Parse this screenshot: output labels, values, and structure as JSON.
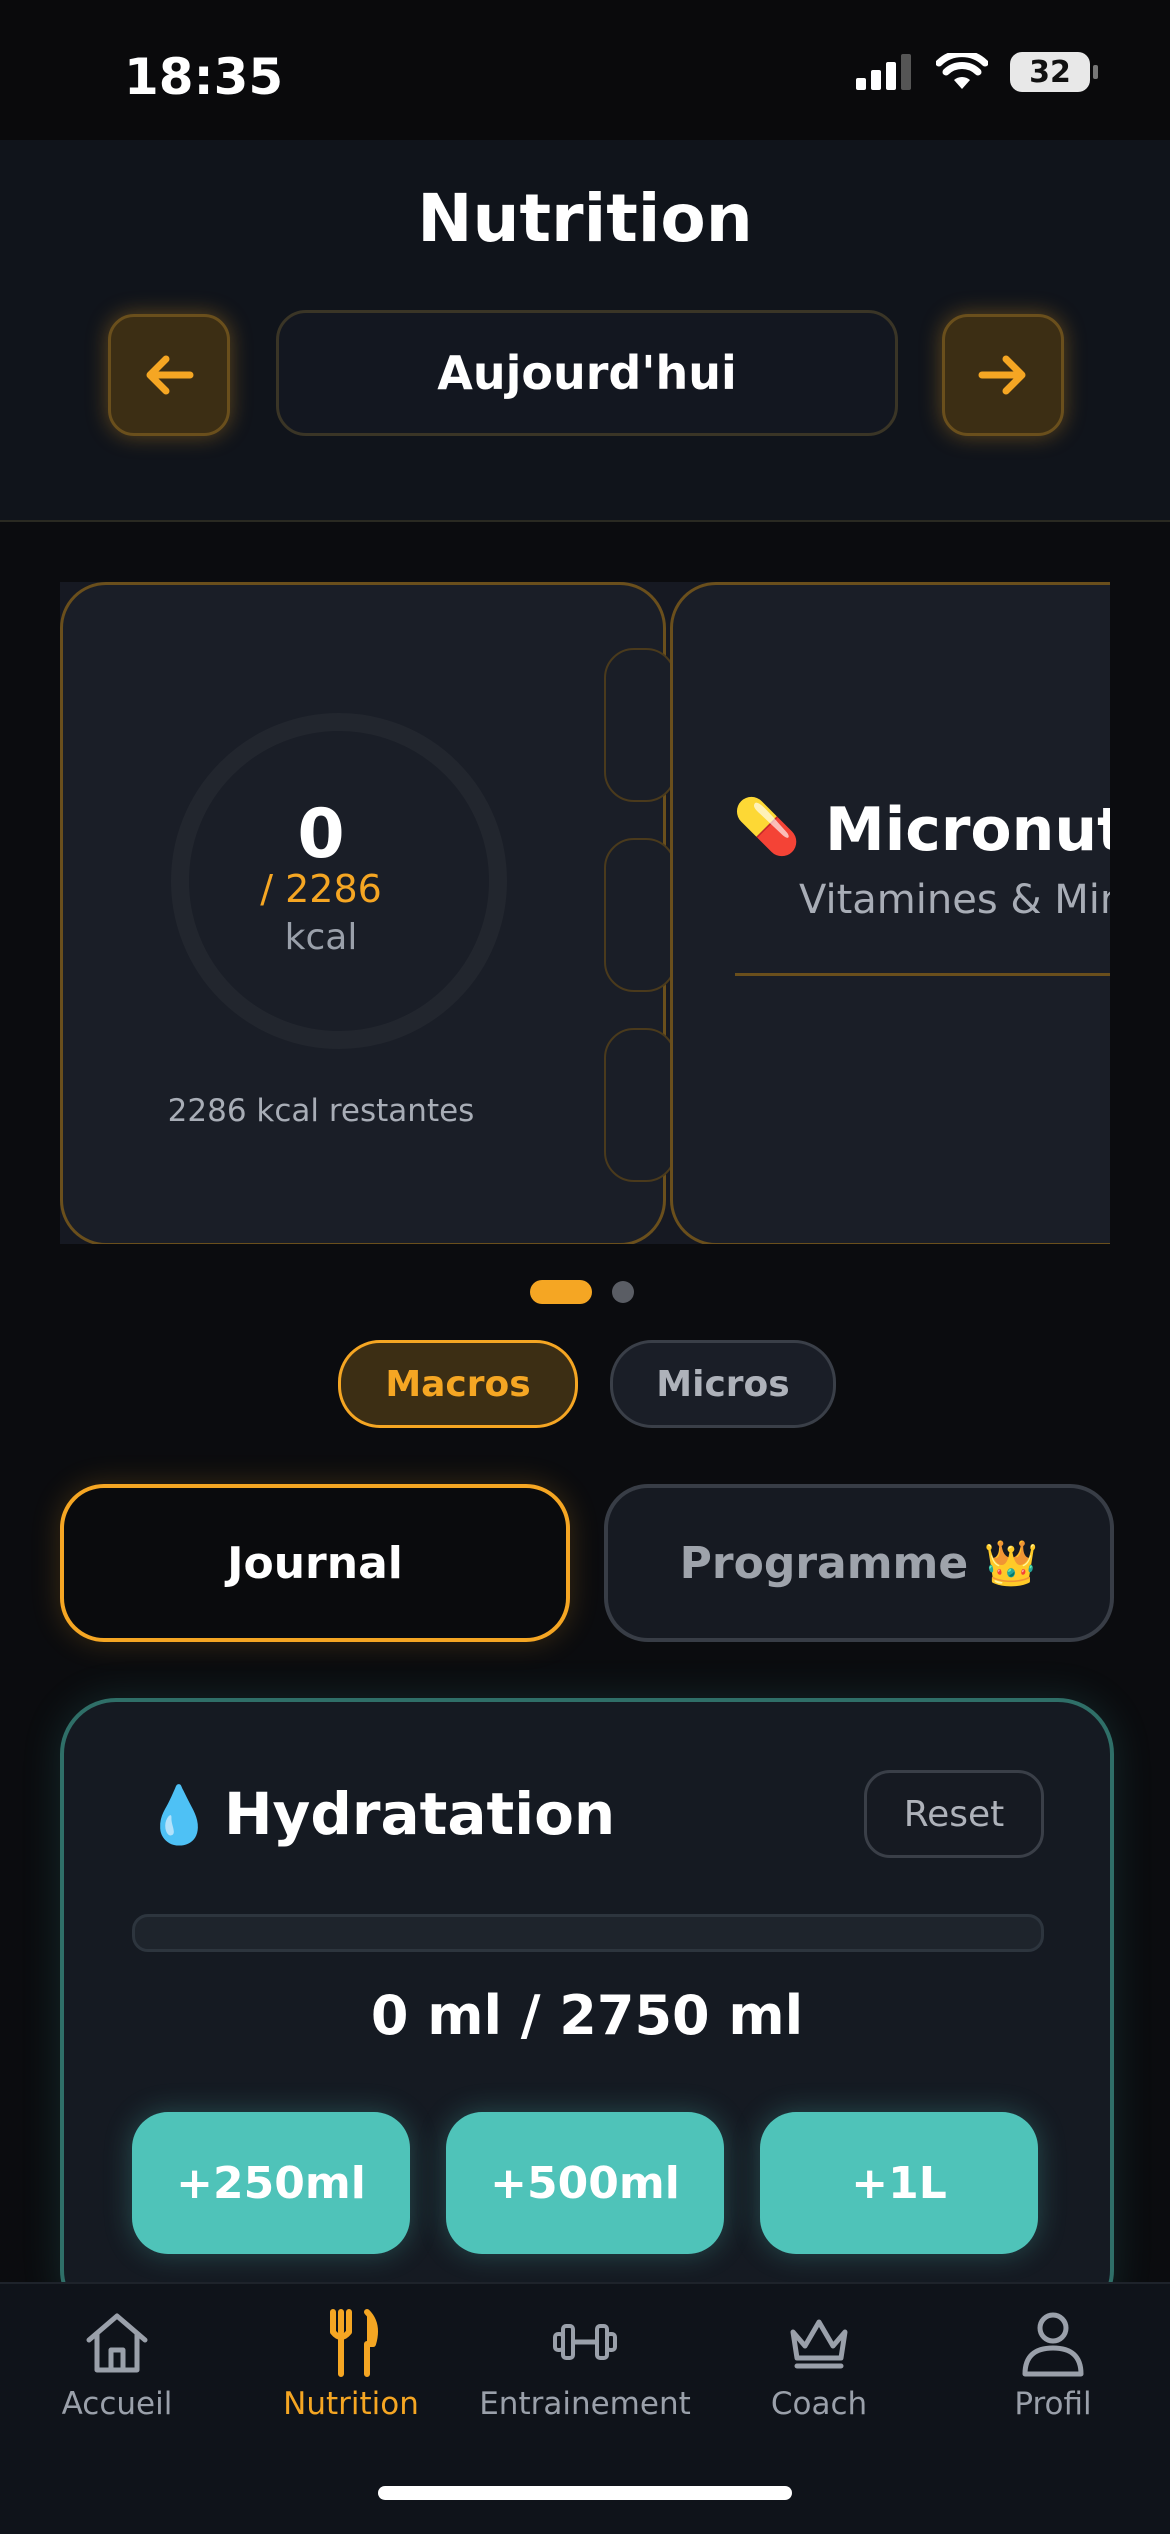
{
  "status": {
    "time": "18:35",
    "battery": "32"
  },
  "header": {
    "title": "Nutrition",
    "date_label": "Aujourd'hui"
  },
  "calories": {
    "value": "0",
    "goal": "/ 2286",
    "unit": "kcal",
    "remaining": "2286 kcal restantes"
  },
  "micro_card": {
    "emoji": "💊",
    "title": "Micronutriments",
    "subtitle": "Vitamines & Minéraux"
  },
  "toggle": {
    "macros": "Macros",
    "micros": "Micros"
  },
  "tabs": {
    "journal": "Journal",
    "programme": "Programme 👑"
  },
  "hydration": {
    "emoji": "💧",
    "title": "Hydratation",
    "reset": "Reset",
    "amount": "0 ml / 2750 ml",
    "progress": 0,
    "buttons": [
      "+250ml",
      "+500ml",
      "+1L"
    ]
  },
  "bottom_nav": [
    {
      "label": "Accueil",
      "icon": "home-icon"
    },
    {
      "label": "Nutrition",
      "icon": "fork-knife-icon",
      "active": true
    },
    {
      "label": "Entrainement",
      "icon": "dumbbell-icon"
    },
    {
      "label": "Coach",
      "icon": "crown-icon"
    },
    {
      "label": "Profil",
      "icon": "person-icon"
    }
  ],
  "colors": {
    "accent": "#f5a623",
    "teal": "#4fc3b9",
    "background": "#0b0c0f"
  }
}
